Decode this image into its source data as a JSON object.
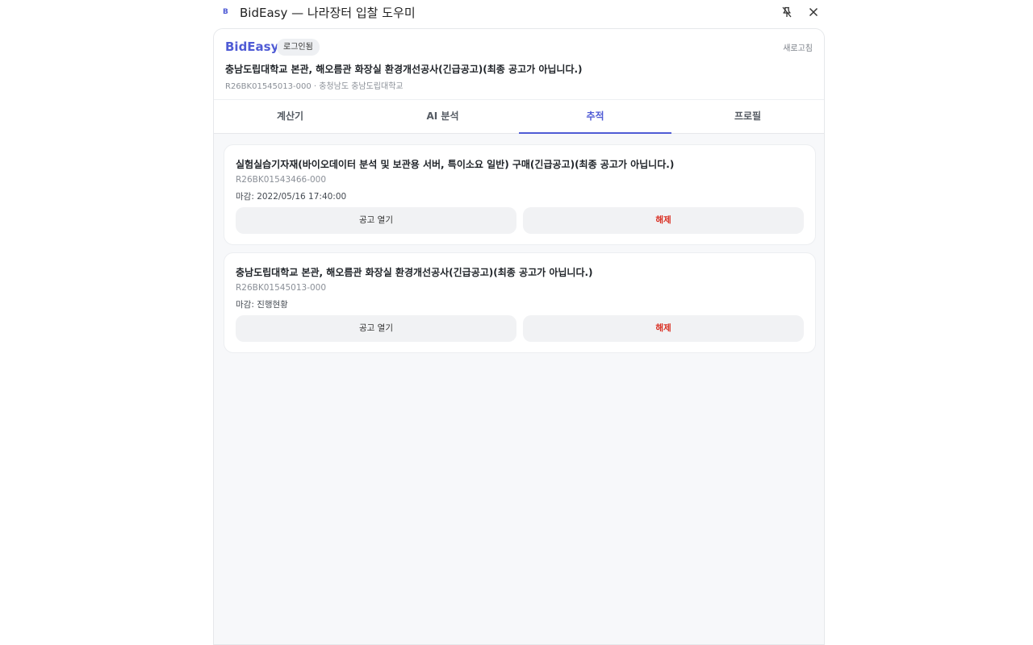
{
  "window": {
    "logo_letter": "B",
    "title": "BidEasy — 나라장터 입찰 도우미",
    "pin_icon": "unpin-icon",
    "close_icon": "close-icon"
  },
  "header": {
    "brand": "BidEasy",
    "login_badge": "로그인됨",
    "refresh_label": "새로고침",
    "bid_title": "충남도립대학교 본관, 해오름관 화장실 환경개선공사(긴급공고)(최종 공고가 아닙니다.)",
    "bid_meta": "R26BK01545013-000 · 충청남도 충남도립대학교"
  },
  "tabs": [
    {
      "label": "계산기",
      "active": false
    },
    {
      "label": "AI 분석",
      "active": false
    },
    {
      "label": "추적",
      "active": true
    },
    {
      "label": "프로필",
      "active": false
    }
  ],
  "tracked": [
    {
      "title": "실험실습기자재(바이오데이터 분석 및 보관용 서버, 특이소요 일반) 구매(긴급공고)(최종 공고가 아닙니다.)",
      "id": "R26BK01543466-000",
      "deadline": "마감: 2022/05/16 17:40:00",
      "open_label": "공고 열기",
      "remove_label": "해제"
    },
    {
      "title": "충남도립대학교 본관, 해오름관 화장실 환경개선공사(긴급공고)(최종 공고가 아닙니다.)",
      "id": "R26BK01545013-000",
      "deadline": "마감: 진행현황",
      "open_label": "공고 열기",
      "remove_label": "해제"
    }
  ],
  "colors": {
    "accent": "#4f5bd5",
    "danger": "#d92d20",
    "panel_bg": "#f7f8fa"
  }
}
